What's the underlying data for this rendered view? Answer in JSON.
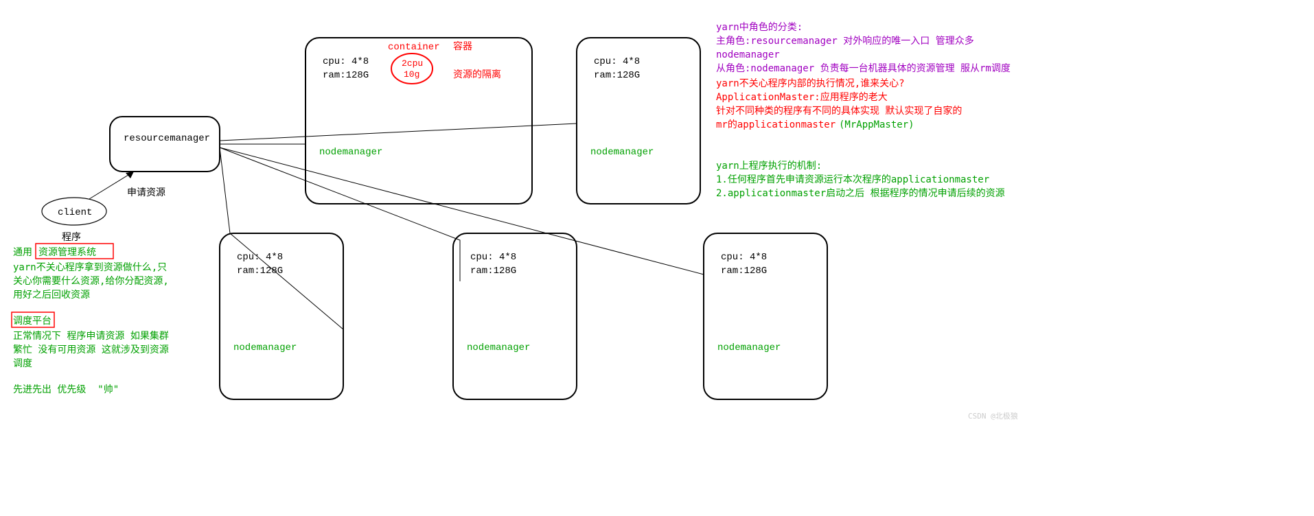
{
  "resourcemanager": {
    "label": "resourcemanager"
  },
  "client": {
    "label": "client",
    "arrow_label": "申请资源",
    "below": "程序"
  },
  "nodes": {
    "cpu": "cpu: 4*8",
    "ram": "ram:128G",
    "label": "nodemanager"
  },
  "container": {
    "title": "container",
    "title_cn": "容器",
    "cpu": "2cpu",
    "ram": "10g",
    "note": "资源的隔离"
  },
  "left_text": {
    "l1_pre": "通用",
    "l1_box": "资源管理系统",
    "l2": "yarn不关心程序拿到资源做什么,只",
    "l3": "关心你需要什么资源,给你分配资源,",
    "l4": "用好之后回收资源",
    "l5_box": "调度平台",
    "l6": "正常情况下 程序申请资源 如果集群",
    "l7": "繁忙 没有可用资源 这就涉及到资源",
    "l8": "调度",
    "l9": "先进先出 优先级  \"帅\""
  },
  "right_text": {
    "p1": "yarn中角色的分类:",
    "p2a": "主角色:resourcemanager 对外响应的唯一入口 管理众多",
    "p2b": "nodemanager",
    "p3": "从角色:nodemanager 负责每一台机器具体的资源管理 服从rm调度",
    "r1": "yarn不关心程序内部的执行情况,谁来关心?",
    "r2": "ApplicationMaster:应用程序的老大",
    "r3": "针对不同种类的程序有不同的具体实现 默认实现了自家的",
    "r4a": "mr的applicationmaster",
    "r4b": "(MrAppMaster)",
    "g1": "yarn上程序执行的机制:",
    "g2": "1.任何程序首先申请资源运行本次程序的applicationmaster",
    "g3": "2.applicationmaster启动之后 根据程序的情况申请后续的资源"
  },
  "watermark": "CSDN @北极狼"
}
